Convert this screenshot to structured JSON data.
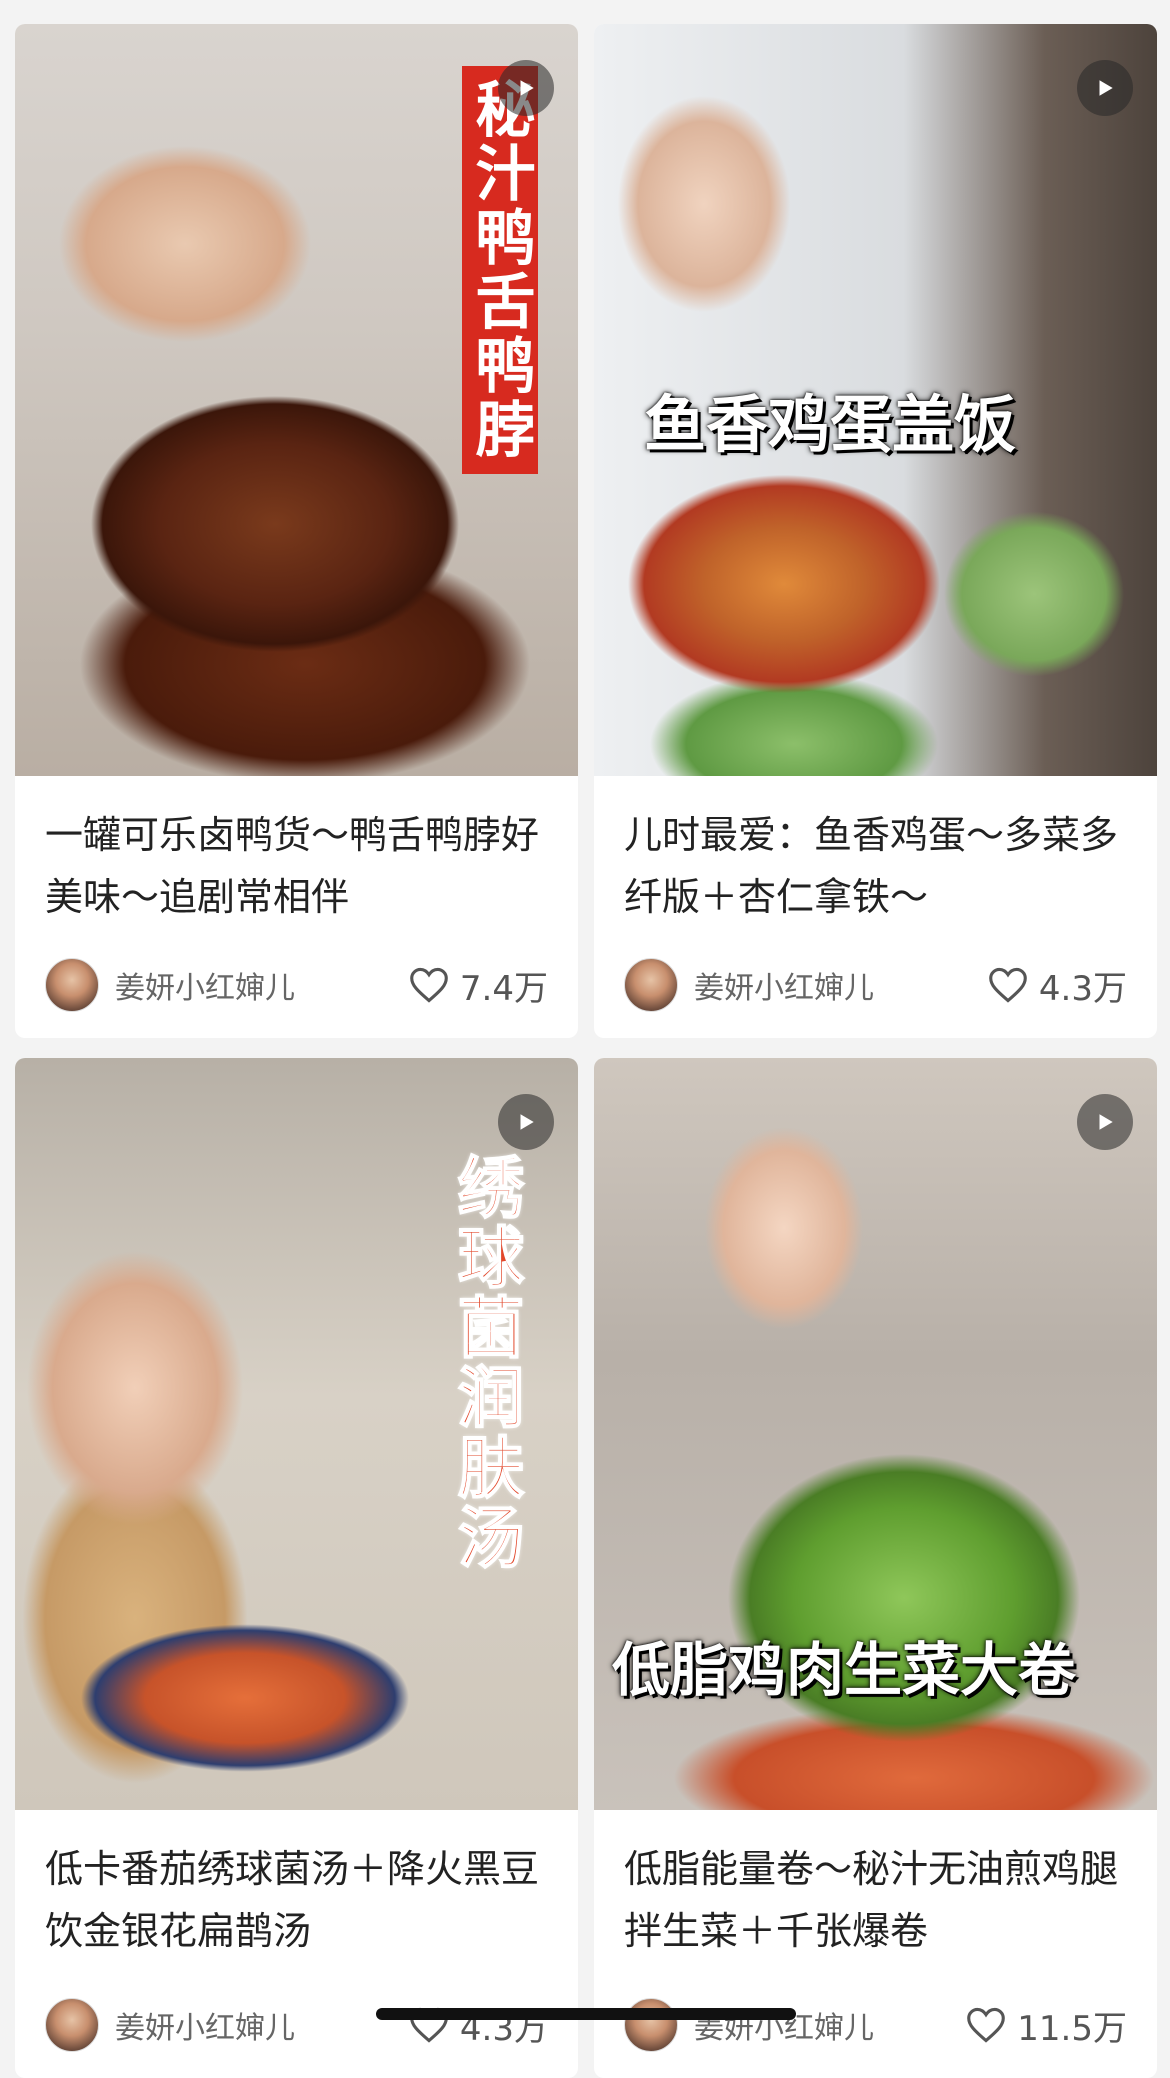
{
  "cards": [
    {
      "overlay": "秘汁鸭舌鸭脖",
      "title": "一罐可乐卤鸭货～鸭舌鸭脖好美味～追剧常相伴",
      "author": "姜妍小红婶儿",
      "likes": "7.4万"
    },
    {
      "overlay": "鱼香鸡蛋盖饭",
      "title": "儿时最爱：鱼香鸡蛋～多菜多纤版＋杏仁拿铁～",
      "author": "姜妍小红婶儿",
      "likes": "4.3万"
    },
    {
      "overlay": "绣球菌润肤汤",
      "title": "低卡番茄绣球菌汤＋降火黑豆饮金银花扁鹊汤",
      "author": "姜妍小红婶儿",
      "likes": "4.3万"
    },
    {
      "overlay": "低脂鸡肉生菜大卷",
      "title": "低脂能量卷～秘汁无油煎鸡腿拌生菜＋千张爆卷",
      "author": "姜妍小红婶儿",
      "likes": "11.5万"
    }
  ],
  "icons": {
    "play": "play-icon",
    "like": "heart-outline-icon"
  },
  "colors": {
    "overlay_red": "#d72a1f",
    "overlay_white": "#ffffff"
  }
}
